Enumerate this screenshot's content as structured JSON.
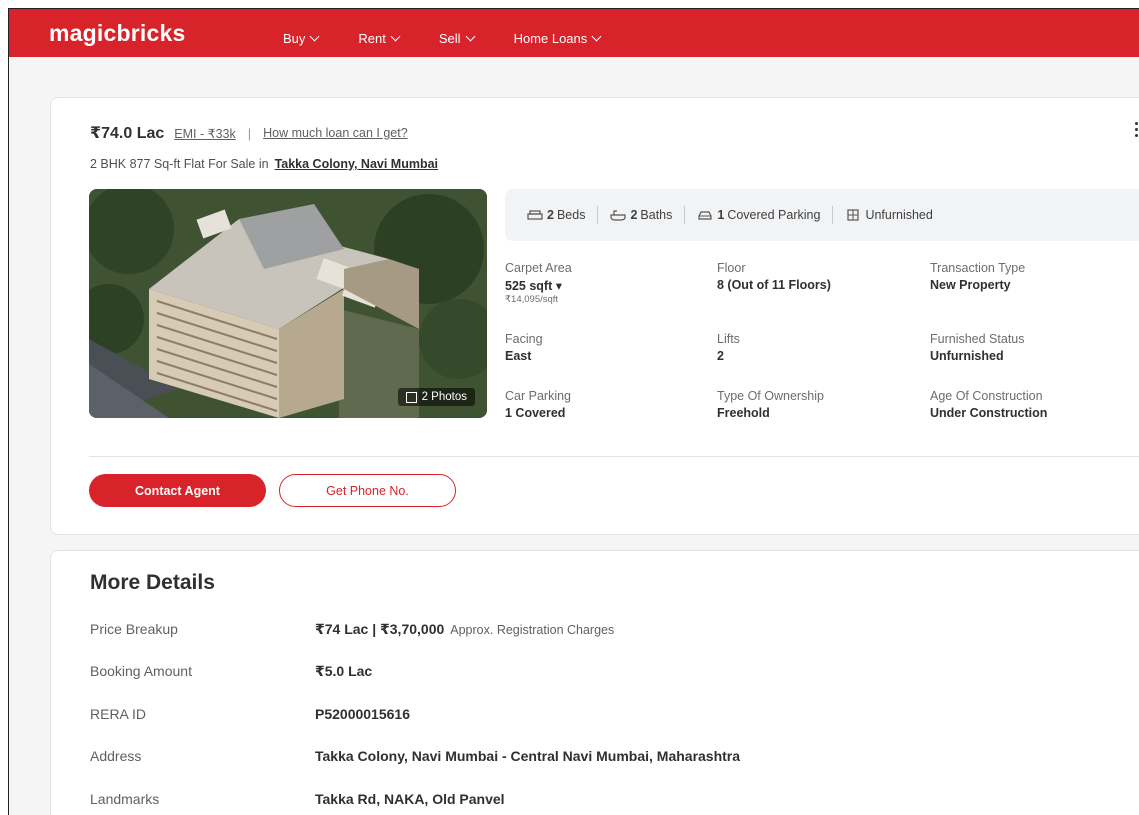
{
  "header": {
    "logo": "magicbricks",
    "nav": [
      {
        "label": "Buy"
      },
      {
        "label": "Rent"
      },
      {
        "label": "Sell"
      },
      {
        "label": "Home Loans"
      }
    ]
  },
  "listing": {
    "price": "₹74.0 Lac",
    "emi_link": "EMI - ₹33k",
    "separator": "|",
    "loan_link": "How much loan can I get?",
    "subtitle_prefix": "2 BHK 877 Sq-ft Flat For Sale in",
    "locality_link": "Takka Colony, Navi Mumbai",
    "photo_badge": "2 Photos",
    "summary": {
      "beds_num": "2",
      "beds_label": "Beds",
      "baths_num": "2",
      "baths_label": "Baths",
      "parking_num": "1",
      "parking_label": "Covered Parking",
      "furnishing": "Unfurnished"
    },
    "details": {
      "carpet_area_label": "Carpet Area",
      "carpet_area_value": "525 sqft ▾",
      "carpet_area_rate": "₹14,095/sqft",
      "floor_label": "Floor",
      "floor_value": "8 (Out of 11 Floors)",
      "transaction_label": "Transaction Type",
      "transaction_value": "New Property",
      "facing_label": "Facing",
      "facing_value": "East",
      "lifts_label": "Lifts",
      "lifts_value": "2",
      "furnished_label": "Furnished Status",
      "furnished_value": "Unfurnished",
      "car_parking_label": "Car Parking",
      "car_parking_value": "1 Covered",
      "ownership_label": "Type Of Ownership",
      "ownership_value": "Freehold",
      "age_label": "Age Of Construction",
      "age_value": "Under Construction"
    },
    "buttons": {
      "contact": "Contact Agent",
      "phone": "Get Phone No."
    }
  },
  "more_details": {
    "title": "More Details",
    "rows": [
      {
        "key": "Price Breakup",
        "value": "₹74 Lac | ₹3,70,000",
        "note": "Approx. Registration Charges"
      },
      {
        "key": "Booking Amount",
        "value": "₹5.0 Lac",
        "note": ""
      },
      {
        "key": "RERA ID",
        "value": "P52000015616",
        "note": ""
      },
      {
        "key": "Address",
        "value": "Takka Colony, Navi Mumbai - Central Navi Mumbai, Maharashtra",
        "note": ""
      },
      {
        "key": "Landmarks",
        "value": "Takka Rd, NAKA, Old Panvel",
        "note": ""
      }
    ]
  },
  "colors": {
    "brand": "#d8232a",
    "summary_bg": "#f2f3f5"
  }
}
